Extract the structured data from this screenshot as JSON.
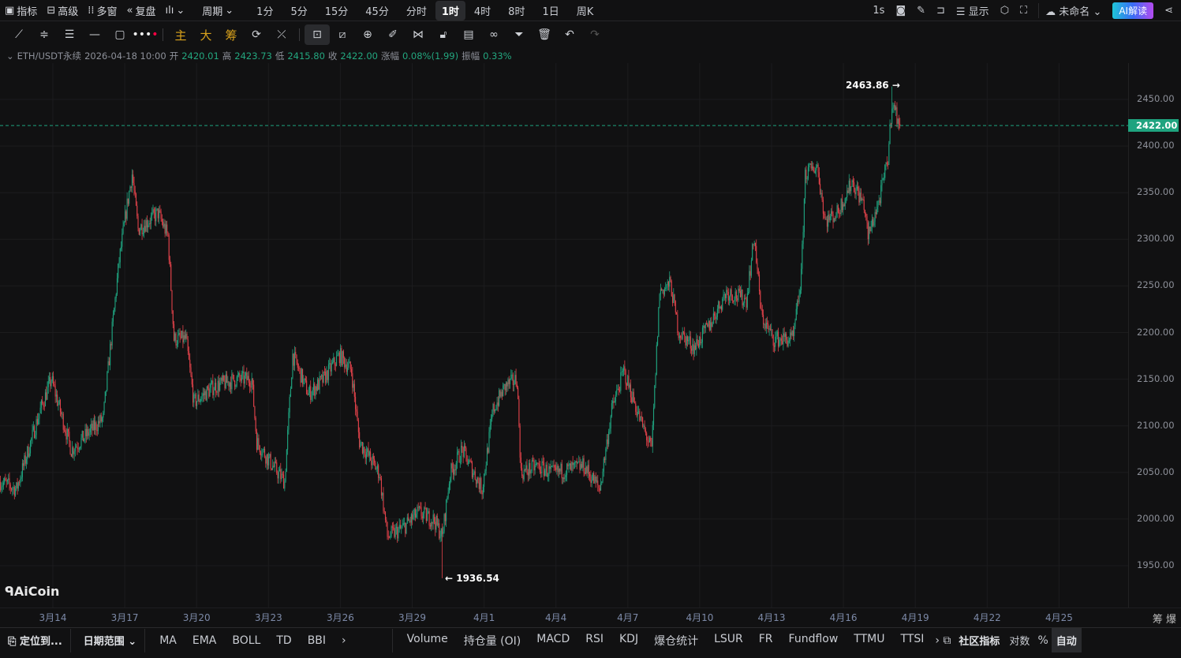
{
  "topbar": {
    "indicators": "指标",
    "advanced": "高级",
    "multi": "多窗",
    "replay": "复盘",
    "period": "周期",
    "periods": [
      "1分",
      "5分",
      "15分",
      "45分",
      "分时",
      "1时",
      "4时",
      "8时",
      "1日",
      "周K"
    ],
    "active_period": "1时",
    "refresh": "1s",
    "display": "显示",
    "layout_name": "未命名",
    "ai": "AI解读"
  },
  "toolbar": {
    "main": "主",
    "big": "大",
    "chip": "筹"
  },
  "info": {
    "symbol": "ETH/USDT永续",
    "time": "2026-04-18 10:00",
    "open_l": "开",
    "open": "2420.01",
    "high_l": "高",
    "high": "2423.73",
    "low_l": "低",
    "low": "2415.80",
    "close_l": "收",
    "close": "2422.00",
    "chg_l": "涨幅",
    "chg": "0.08%(1.99)",
    "amp_l": "振幅",
    "amp": "0.33%"
  },
  "price_axis": {
    "labels": [
      "2450.00",
      "2400.00",
      "2350.00",
      "2300.00",
      "2250.00",
      "2200.00",
      "2150.00",
      "2100.00",
      "2050.00",
      "2000.00",
      "1950.00"
    ],
    "current": "2422.00"
  },
  "annotations": {
    "max": "2463.86",
    "min": "1936.54"
  },
  "date_axis": [
    "3月14",
    "3月17",
    "3月20",
    "3月23",
    "3月26",
    "3月29",
    "4月1",
    "4月4",
    "4月7",
    "4月10",
    "4月13",
    "4月16",
    "4月19",
    "4月22",
    "4月25"
  ],
  "corner": {
    "chip": "筹",
    "liq": "爆"
  },
  "logo": "AiCoin",
  "bottom": {
    "locate": "定位到...",
    "range": "日期范围",
    "main_ind": [
      "MA",
      "EMA",
      "BOLL",
      "TD",
      "BBI"
    ],
    "more": "›",
    "sub_ind": [
      "Volume",
      "持仓量 (OI)",
      "MACD",
      "RSI",
      "KDJ",
      "爆仓统计",
      "LSUR",
      "FR",
      "Fundflow",
      "TTMU",
      "TTSI"
    ],
    "community": "社区指标",
    "log": "对数",
    "pct": "%",
    "auto": "自动"
  },
  "colors": {
    "up": "#1fa37f",
    "down": "#e0424a",
    "bg": "#111112"
  },
  "chart_data": {
    "type": "candlestick",
    "interval": "1h",
    "last_time": "2026-04-18 10:00",
    "ylim": [
      1920,
      2480
    ],
    "path_hours_price": [
      [
        0,
        2040
      ],
      [
        16,
        2032
      ],
      [
        40,
        2117
      ],
      [
        51,
        2150
      ],
      [
        71,
        2074
      ],
      [
        103,
        2108
      ],
      [
        111,
        2193
      ],
      [
        119,
        2277
      ],
      [
        127,
        2337
      ],
      [
        132,
        2370
      ],
      [
        138,
        2311
      ],
      [
        158,
        2328
      ],
      [
        168,
        2303
      ],
      [
        174,
        2193
      ],
      [
        186,
        2193
      ],
      [
        194,
        2125
      ],
      [
        214,
        2142
      ],
      [
        237,
        2150
      ],
      [
        252,
        2150
      ],
      [
        257,
        2083
      ],
      [
        273,
        2057
      ],
      [
        285,
        2040
      ],
      [
        293,
        2176
      ],
      [
        309,
        2134
      ],
      [
        324,
        2150
      ],
      [
        340,
        2176
      ],
      [
        352,
        2159
      ],
      [
        360,
        2083
      ],
      [
        380,
        2049
      ],
      [
        388,
        1981
      ],
      [
        403,
        1990
      ],
      [
        419,
        2007
      ],
      [
        435,
        1999
      ],
      [
        443,
        1981
      ],
      [
        451,
        2049
      ],
      [
        463,
        2074
      ],
      [
        475,
        2049
      ],
      [
        483,
        2032
      ],
      [
        494,
        2117
      ],
      [
        506,
        2142
      ],
      [
        518,
        2150
      ],
      [
        522,
        2049
      ],
      [
        538,
        2057
      ],
      [
        554,
        2049
      ],
      [
        585,
        2057
      ],
      [
        601,
        2032
      ],
      [
        613,
        2117
      ],
      [
        625,
        2159
      ],
      [
        641,
        2108
      ],
      [
        653,
        2074
      ],
      [
        661,
        2244
      ],
      [
        672,
        2252
      ],
      [
        680,
        2201
      ],
      [
        696,
        2184
      ],
      [
        712,
        2210
      ],
      [
        728,
        2244
      ],
      [
        748,
        2235
      ],
      [
        756,
        2303
      ],
      [
        763,
        2218
      ],
      [
        775,
        2193
      ],
      [
        795,
        2193
      ],
      [
        803,
        2260
      ],
      [
        807,
        2370
      ],
      [
        819,
        2379
      ],
      [
        827,
        2320
      ],
      [
        839,
        2328
      ],
      [
        854,
        2362
      ],
      [
        866,
        2337
      ],
      [
        870,
        2303
      ],
      [
        882,
        2345
      ],
      [
        890,
        2387
      ],
      [
        894,
        2447
      ],
      [
        902,
        2422
      ]
    ]
  }
}
